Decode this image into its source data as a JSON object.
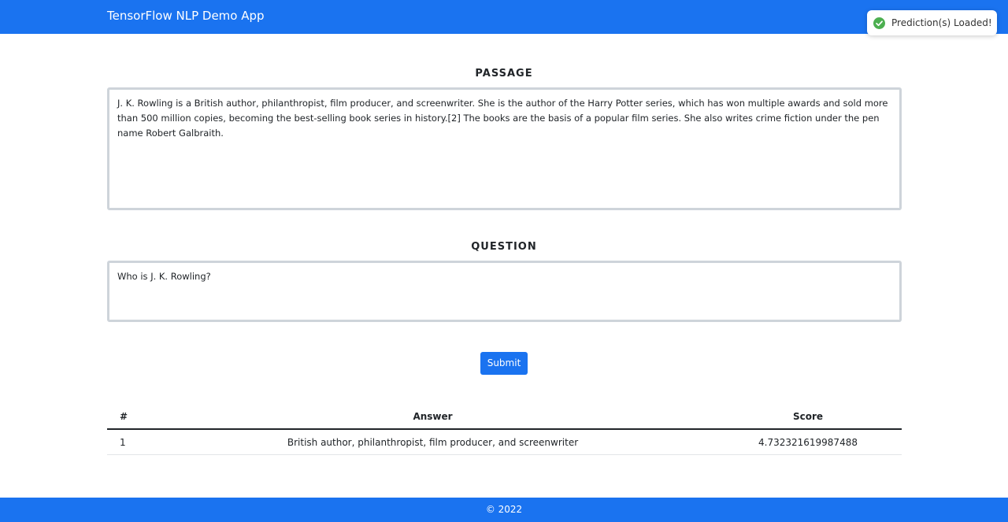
{
  "app": {
    "title": "TensorFlow NLP Demo App"
  },
  "toast": {
    "message": "Prediction(s) Loaded!",
    "icon": "check-circle-icon",
    "color": "#4caf50"
  },
  "passage": {
    "heading": "PASSAGE",
    "value": "J. K. Rowling is a British author, philanthropist, film producer, and screenwriter. She is the author of the Harry Potter series, which has won multiple awards and sold more than 500 million copies, becoming the best-selling book series in history.[2] The books are the basis of a popular film series. She also writes crime fiction under the pen name Robert Galbraith."
  },
  "question": {
    "heading": "QUESTION",
    "value": "Who is J. K. Rowling?"
  },
  "actions": {
    "submit_label": "Submit"
  },
  "results": {
    "columns": [
      "#",
      "Answer",
      "Score"
    ],
    "rows": [
      {
        "index": "1",
        "answer": "British author, philanthropist, film producer, and screenwriter",
        "score": "4.732321619987488"
      }
    ]
  },
  "footer": {
    "text": "© 2022"
  },
  "colors": {
    "primary": "#1a73f0",
    "border": "#ced4da"
  }
}
